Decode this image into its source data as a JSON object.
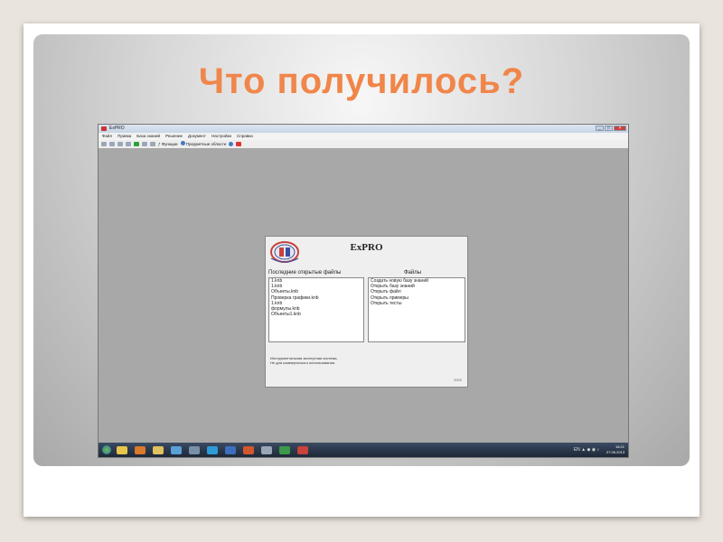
{
  "slide": {
    "title": "Что получилось?",
    "accent_color": "#f0864a"
  },
  "window": {
    "title": "ExPRO",
    "menu": [
      "Файл",
      "Правка",
      "База знаний",
      "Решение",
      "Документ",
      "Настройки",
      "Справка"
    ],
    "toolbar": {
      "functions_label": "Функции",
      "subject_areas_label": "Предметные области"
    }
  },
  "dialog": {
    "app_name": "ExPRO",
    "recent_header": "Последние открытые файлы",
    "recent_files": [
      "1.knb",
      "1.knb",
      "Объекты.knb",
      "Проверка графики.knb",
      "1.knb",
      "формулы.knb",
      "Объекты1.knb"
    ],
    "files_header": "Файлы",
    "file_actions": [
      "Создать новую базу знаний",
      "Открыть базу знаний",
      "Открыть файл",
      "Открыть примеры",
      "Открыть тесты"
    ],
    "footer_line1": "Инструментальная экспертная система.",
    "footer_line2": "Не для коммерческого использования.",
    "version": "3200"
  },
  "taskbar": {
    "icons": [
      "start-orb-icon",
      "explorer-icon",
      "media-icon",
      "folder-icon",
      "paint-icon",
      "network-icon",
      "skype-icon",
      "word-icon",
      "powerpoint-icon",
      "app-icon",
      "excel-icon",
      "expro-icon"
    ],
    "lang": "EN",
    "time": "16:21",
    "date": "27.06.2013"
  }
}
